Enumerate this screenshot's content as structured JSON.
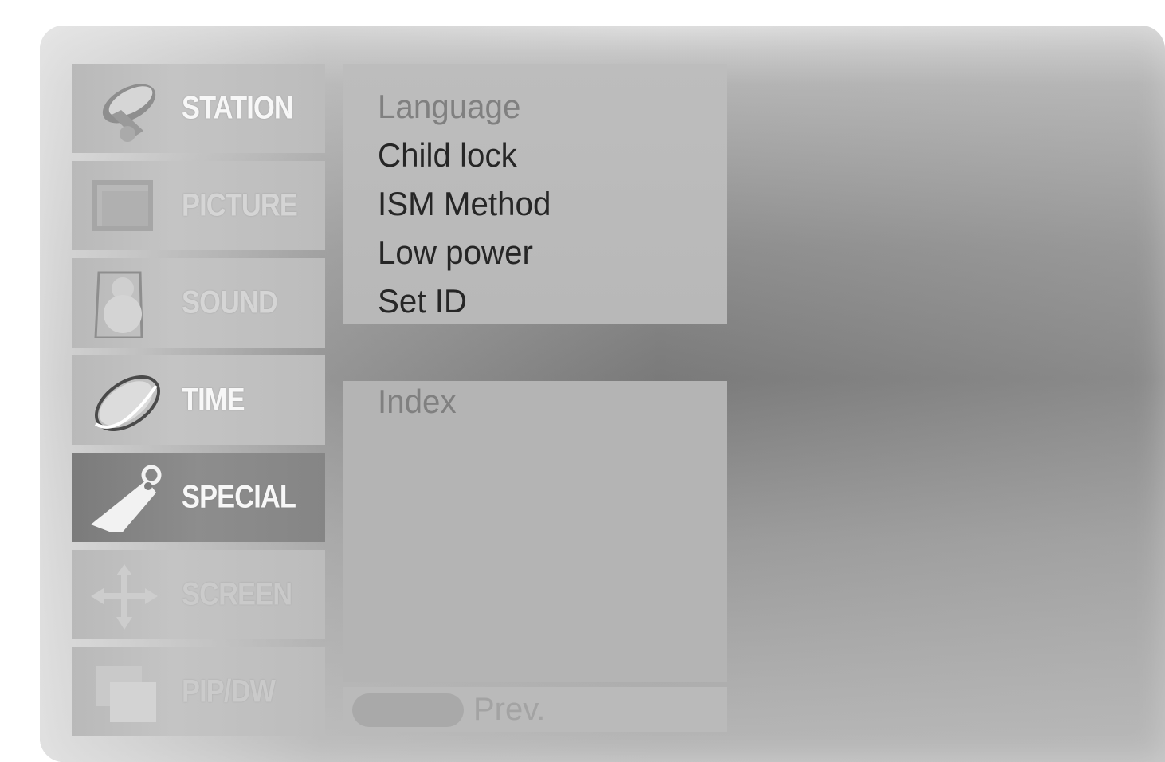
{
  "menu": {
    "categories": [
      {
        "label": "STATION",
        "icon": "satellite-dish-icon",
        "state": "normal"
      },
      {
        "label": "PICTURE",
        "icon": "picture-icon",
        "state": "dim"
      },
      {
        "label": "SOUND",
        "icon": "speaker-icon",
        "state": "dim"
      },
      {
        "label": "TIME",
        "icon": "clock-ring-icon",
        "state": "normal"
      },
      {
        "label": "SPECIAL",
        "icon": "tag-icon",
        "state": "selected"
      },
      {
        "label": "SCREEN",
        "icon": "move-arrows-icon",
        "state": "faded"
      },
      {
        "label": "PIP/DW",
        "icon": "pip-icon",
        "state": "faded"
      }
    ]
  },
  "submenu": {
    "items": [
      {
        "label": "Language",
        "muted": true
      },
      {
        "label": "Child lock",
        "muted": false
      },
      {
        "label": "ISM Method",
        "muted": false
      },
      {
        "label": "Low power",
        "muted": false
      },
      {
        "label": "Set ID",
        "muted": false
      }
    ]
  },
  "index_panel": {
    "label": "Index"
  },
  "footer": {
    "prev_label": "Prev."
  },
  "colors": {
    "selected_bg": "#858585",
    "panel_bg": "#b8b8b8",
    "text_dark": "#262626",
    "text_muted": "#808080"
  }
}
